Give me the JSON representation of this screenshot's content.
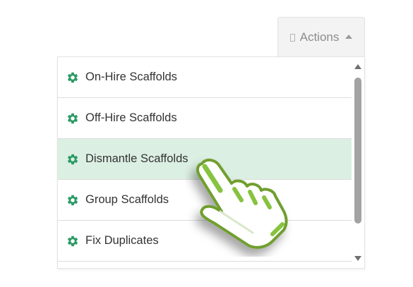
{
  "actions_button": {
    "label": "Actions",
    "icon": "box-icon",
    "caret_icon": "caret-up-icon"
  },
  "menu": {
    "item_icon": "gear-icon",
    "items": [
      {
        "label": "On-Hire Scaffolds"
      },
      {
        "label": "Off-Hire Scaffolds"
      },
      {
        "label": "Dismantle Scaffolds",
        "highlighted": true
      },
      {
        "label": "Group Scaffolds"
      },
      {
        "label": "Fix Duplicates"
      }
    ]
  },
  "colors": {
    "icon_green": "#2c9a65",
    "highlight_background": "#dcefe3",
    "cursor_green": "#86c341",
    "cursor_dark_green": "#5f9126"
  },
  "cursor": {
    "icon": "hand-pointer-icon"
  }
}
